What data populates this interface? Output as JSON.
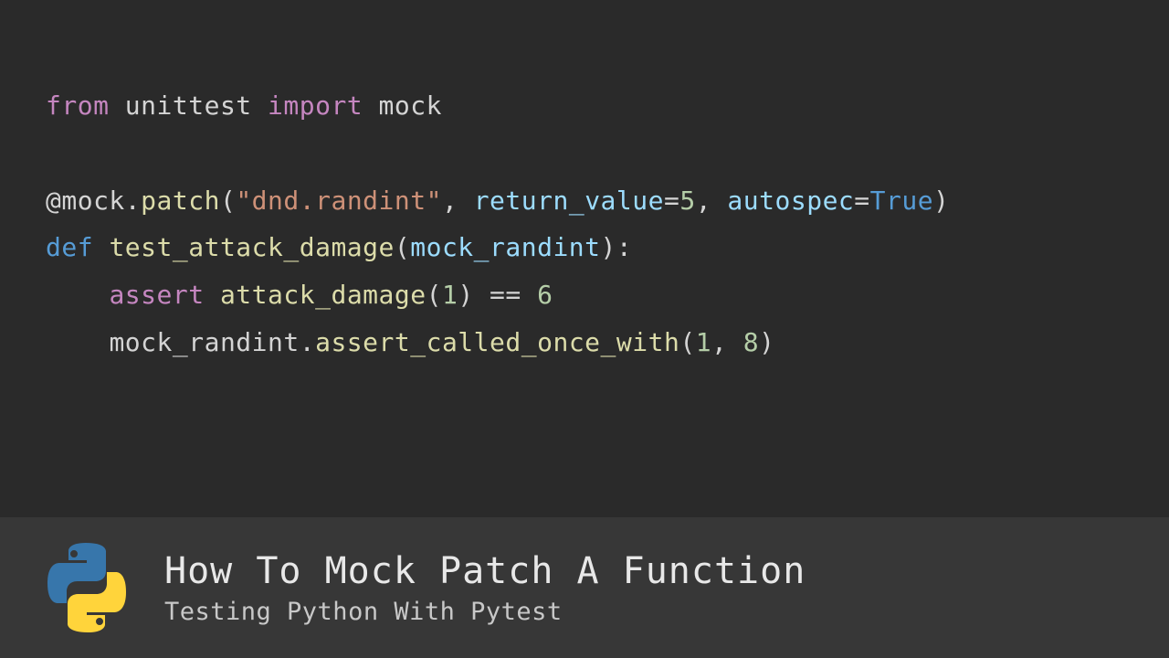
{
  "code": {
    "l1": {
      "from": "from",
      "mod": "unittest",
      "import": "import",
      "name": "mock"
    },
    "l2": {
      "at": "@mock",
      "dot": ".",
      "patch": "patch",
      "open": "(",
      "str": "\"dnd.randint\"",
      "comma1": ", ",
      "kw1": "return_value",
      "eq1": "=",
      "val1": "5",
      "comma2": ", ",
      "kw2": "autospec",
      "eq2": "=",
      "val2": "True",
      "close": ")"
    },
    "l3": {
      "def": "def",
      "fn": "test_attack_damage",
      "open": "(",
      "param": "mock_randint",
      "close": "):"
    },
    "l4": {
      "indent": "    ",
      "assert": "assert",
      "call": "attack_damage",
      "open": "(",
      "arg": "1",
      "close": ") ",
      "op": "==",
      "sp": " ",
      "val": "6"
    },
    "l5": {
      "indent": "    ",
      "obj": "mock_randint",
      "dot": ".",
      "method": "assert_called_once_with",
      "open": "(",
      "a1": "1",
      "comma": ", ",
      "a2": "8",
      "close": ")"
    }
  },
  "banner": {
    "title": "How To Mock Patch A Function",
    "subtitle": "Testing Python With Pytest"
  }
}
